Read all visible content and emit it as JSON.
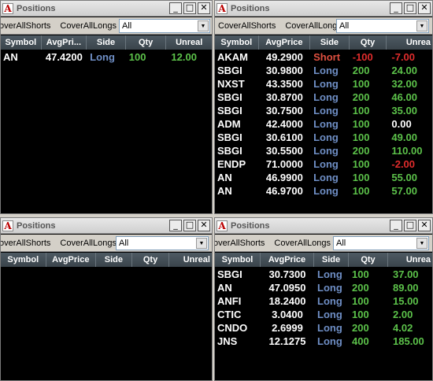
{
  "panels": [
    {
      "title": "Positions",
      "toolbar": {
        "cover_shorts": "overAllShorts",
        "cover_longs": "CoverAllLongs",
        "filter": "All"
      },
      "columns": [
        "Symbol",
        "AvgPri...",
        "Side",
        "Qty",
        "Unreal"
      ],
      "rows": [
        {
          "symbol": "AN",
          "avg": "47.4200",
          "side": "Long",
          "qty": "100",
          "unreal": "12.00"
        }
      ]
    },
    {
      "title": "Positions",
      "toolbar": {
        "cover_shorts": "CoverAllShorts",
        "cover_longs": "CoverAllLongs",
        "filter": "All"
      },
      "columns": [
        "Symbol",
        "AvgPrice",
        "Side",
        "Qty",
        "Unrea"
      ],
      "rows": [
        {
          "symbol": "AKAM",
          "avg": "49.2900",
          "side": "Short",
          "qty": "-100",
          "unreal": "-7.00"
        },
        {
          "symbol": "SBGI",
          "avg": "30.9800",
          "side": "Long",
          "qty": "200",
          "unreal": "24.00"
        },
        {
          "symbol": "NXST",
          "avg": "43.3500",
          "side": "Long",
          "qty": "100",
          "unreal": "32.00"
        },
        {
          "symbol": "SBGI",
          "avg": "30.8700",
          "side": "Long",
          "qty": "200",
          "unreal": "46.00"
        },
        {
          "symbol": "SBGI",
          "avg": "30.7500",
          "side": "Long",
          "qty": "100",
          "unreal": "35.00"
        },
        {
          "symbol": "ADM",
          "avg": "42.4000",
          "side": "Long",
          "qty": "100",
          "unreal": "0.00"
        },
        {
          "symbol": "SBGI",
          "avg": "30.6100",
          "side": "Long",
          "qty": "100",
          "unreal": "49.00"
        },
        {
          "symbol": "SBGI",
          "avg": "30.5500",
          "side": "Long",
          "qty": "200",
          "unreal": "110.00"
        },
        {
          "symbol": "ENDP",
          "avg": "71.0000",
          "side": "Long",
          "qty": "100",
          "unreal": "-2.00"
        },
        {
          "symbol": "AN",
          "avg": "46.9900",
          "side": "Long",
          "qty": "100",
          "unreal": "55.00"
        },
        {
          "symbol": "AN",
          "avg": "46.9700",
          "side": "Long",
          "qty": "100",
          "unreal": "57.00"
        }
      ]
    },
    {
      "title": "Positions",
      "toolbar": {
        "cover_shorts": "overAllShorts",
        "cover_longs": "CoverAllLongs",
        "filter": "All"
      },
      "columns": [
        "Symbol",
        "AvgPrice",
        "Side",
        "Qty",
        "Unreal"
      ],
      "rows": []
    },
    {
      "title": "Positions",
      "toolbar": {
        "cover_shorts": "overAllShorts",
        "cover_longs": "CoverAllLongs",
        "filter": "All"
      },
      "columns": [
        "Symbol",
        "AvgPrice",
        "Side",
        "Qty",
        "Unrea"
      ],
      "rows": [
        {
          "symbol": "SBGI",
          "avg": "30.7300",
          "side": "Long",
          "qty": "100",
          "unreal": "37.00"
        },
        {
          "symbol": "AN",
          "avg": "47.0950",
          "side": "Long",
          "qty": "200",
          "unreal": "89.00"
        },
        {
          "symbol": "ANFI",
          "avg": "18.2400",
          "side": "Long",
          "qty": "100",
          "unreal": "15.00"
        },
        {
          "symbol": "CTIC",
          "avg": "3.0400",
          "side": "Long",
          "qty": "100",
          "unreal": "2.00"
        },
        {
          "symbol": "CNDO",
          "avg": "2.6999",
          "side": "Long",
          "qty": "200",
          "unreal": "4.02"
        },
        {
          "symbol": "JNS",
          "avg": "12.1275",
          "side": "Long",
          "qty": "400",
          "unreal": "185.00"
        }
      ]
    }
  ],
  "window_buttons": {
    "minimize": "_",
    "maximize": "□",
    "close": "✕"
  },
  "app_icon_letter": "A",
  "colors": {
    "long": "#6f8fc6",
    "short": "#e05040",
    "positive": "#5cc24a",
    "negative": "#e02c2c",
    "header_bg": "#3a444b"
  }
}
